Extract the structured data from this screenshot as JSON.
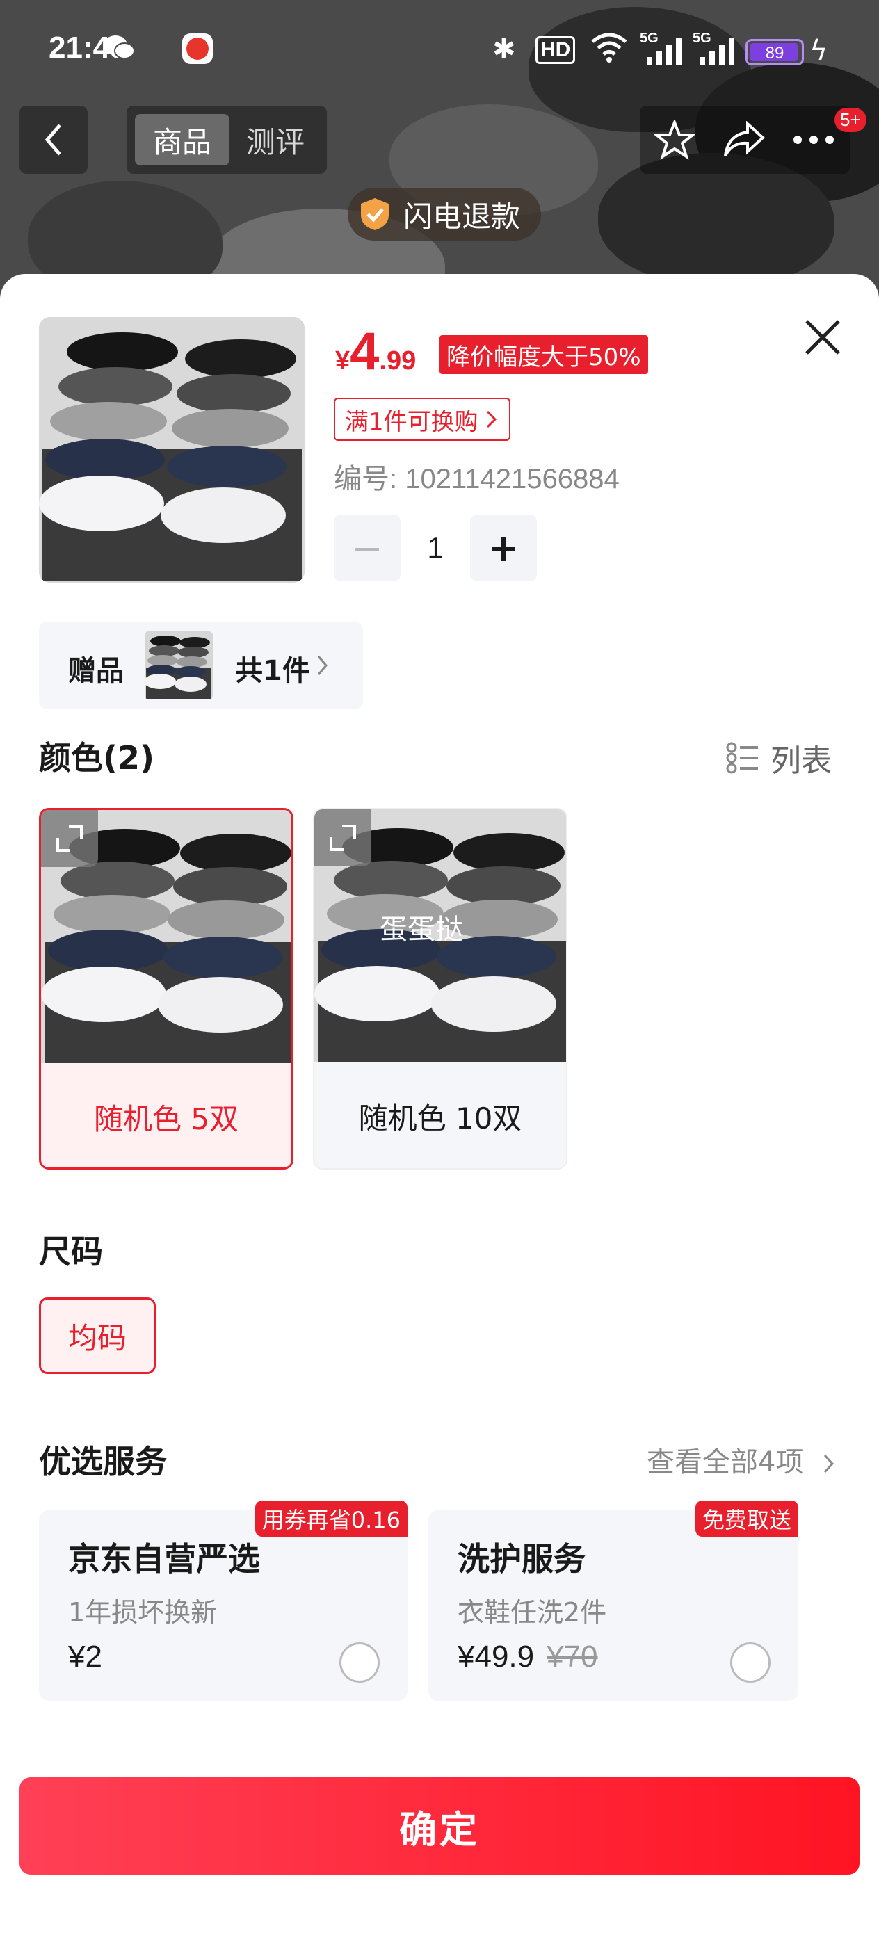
{
  "status_bar": {
    "time": "21:48",
    "battery": "89",
    "signal_1": "5G",
    "signal_2": "5G",
    "hd": "HD"
  },
  "nav": {
    "tab_product": "商品",
    "tab_review": "测评",
    "more_badge": "5+",
    "flash_refund": "闪电退款"
  },
  "product": {
    "price_currency": "¥",
    "price_int": "4",
    "price_dec": ".99",
    "discount_tag": "降价幅度大于50%",
    "swap_tag": "满1件可换购",
    "sku": "编号: 10211421566884",
    "quantity": "1",
    "minus_label": "−",
    "plus_label": "+"
  },
  "gift": {
    "label": "赠品",
    "count": "共1件"
  },
  "color_section": {
    "title": "颜色(2)",
    "list_toggle": "列表",
    "options": [
      {
        "label": "随机色 5双",
        "selected": true
      },
      {
        "label": "随机色 10双",
        "selected": false,
        "watermark": "蛋蛋挞"
      }
    ]
  },
  "size_section": {
    "title": "尺码",
    "options": [
      {
        "label": "均码",
        "selected": true
      }
    ]
  },
  "services": {
    "title": "优选服务",
    "view_all": "查看全部4项",
    "items": [
      {
        "name": "京东自营严选",
        "desc": "1年损坏换新",
        "price": "¥2",
        "original_price": "",
        "badge": "用券再省0.16"
      },
      {
        "name": "洗护服务",
        "desc": "衣鞋任洗2件",
        "price": "¥49.9",
        "original_price": "¥70",
        "badge": "免费取送"
      }
    ]
  },
  "confirm_label": "确定",
  "colors": {
    "accent": "#e8202d",
    "card_bg": "#f5f6fa",
    "button_gradient_start": "#ff4056",
    "button_gradient_end": "#ff1423"
  }
}
